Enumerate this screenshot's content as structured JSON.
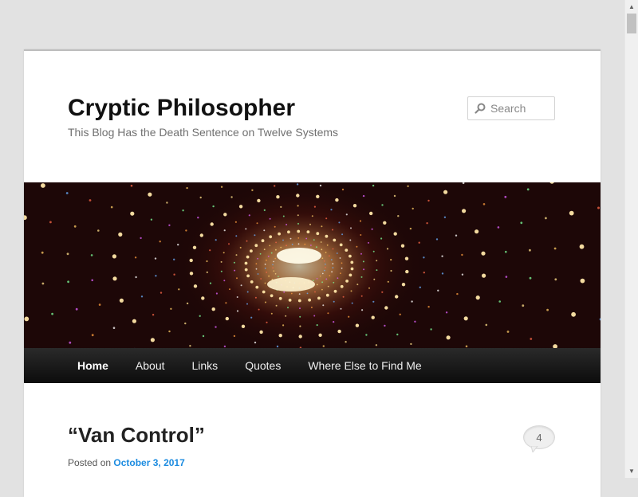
{
  "site": {
    "title": "Cryptic Philosopher",
    "description": "This Blog Has the Death Sentence on Twelve Systems"
  },
  "search": {
    "placeholder": "Search",
    "icon": "search-icon"
  },
  "nav": {
    "items": [
      {
        "label": "Home",
        "active": true
      },
      {
        "label": "About",
        "active": false
      },
      {
        "label": "Links",
        "active": false
      },
      {
        "label": "Quotes",
        "active": false
      },
      {
        "label": "Where Else to Find Me",
        "active": false
      }
    ]
  },
  "post": {
    "title": "“Van Control”",
    "comment_count": "4",
    "posted_on_label": "Posted on",
    "date": "October 3, 2017"
  },
  "colors": {
    "background": "#e2e2e2",
    "link": "#1b8be0",
    "nav_bg": "#1a1a1a",
    "title": "#111111"
  }
}
